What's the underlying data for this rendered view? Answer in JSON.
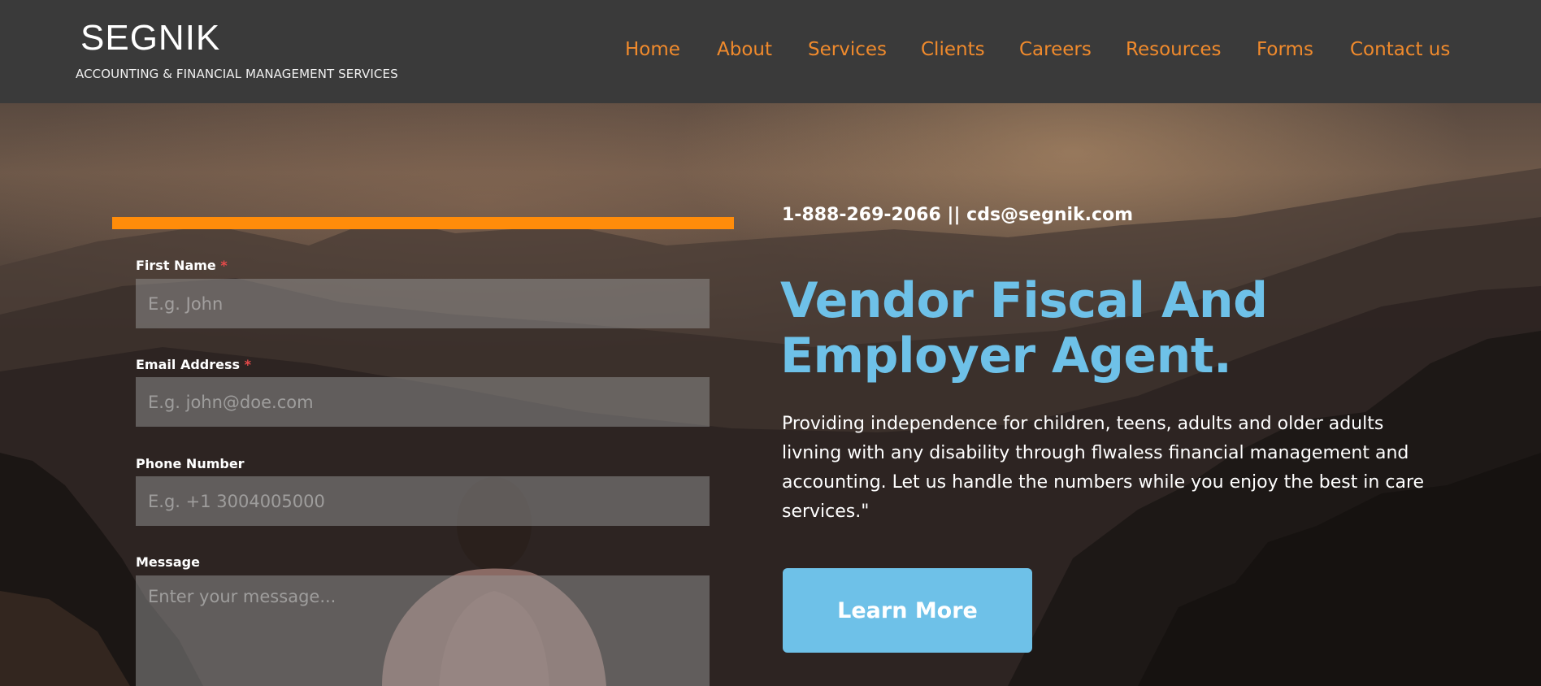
{
  "header": {
    "brand_name": "SEGNIK",
    "brand_tagline": "ACCOUNTING & FINANCIAL MANAGEMENT SERVICES",
    "nav": [
      "Home",
      "About",
      "Services",
      "Clients",
      "Careers",
      "Resources",
      "Forms",
      "Contact us"
    ]
  },
  "form": {
    "first_name": {
      "label": "First Name",
      "required_mark": "*",
      "placeholder": "E.g. John",
      "value": ""
    },
    "email": {
      "label": "Email Address",
      "required_mark": "*",
      "placeholder": "E.g. john@doe.com",
      "value": ""
    },
    "phone": {
      "label": "Phone Number",
      "placeholder": "E.g. +1 3004005000",
      "value": ""
    },
    "message": {
      "label": "Message",
      "placeholder": "Enter your message...",
      "value": ""
    }
  },
  "hero": {
    "contact_line": "1-888-269-2066 || cds@segnik.com",
    "headline_line1": "Vendor Fiscal And",
    "headline_line2": "Employer Agent.",
    "description": " Providing independence for children, teens, adults and older adults livning with any disability through flwaless financial management and accounting. Let us handle the numbers while you enjoy the best in care services.\"",
    "cta_label": "Learn More"
  },
  "colors": {
    "header_bg": "#3a3a3a",
    "nav_text": "#f08a2c",
    "accent_bar": "#ff8c0a",
    "headline": "#6ec1e8",
    "cta_bg": "#6ec1e8",
    "required_mark": "#e84a4a"
  }
}
